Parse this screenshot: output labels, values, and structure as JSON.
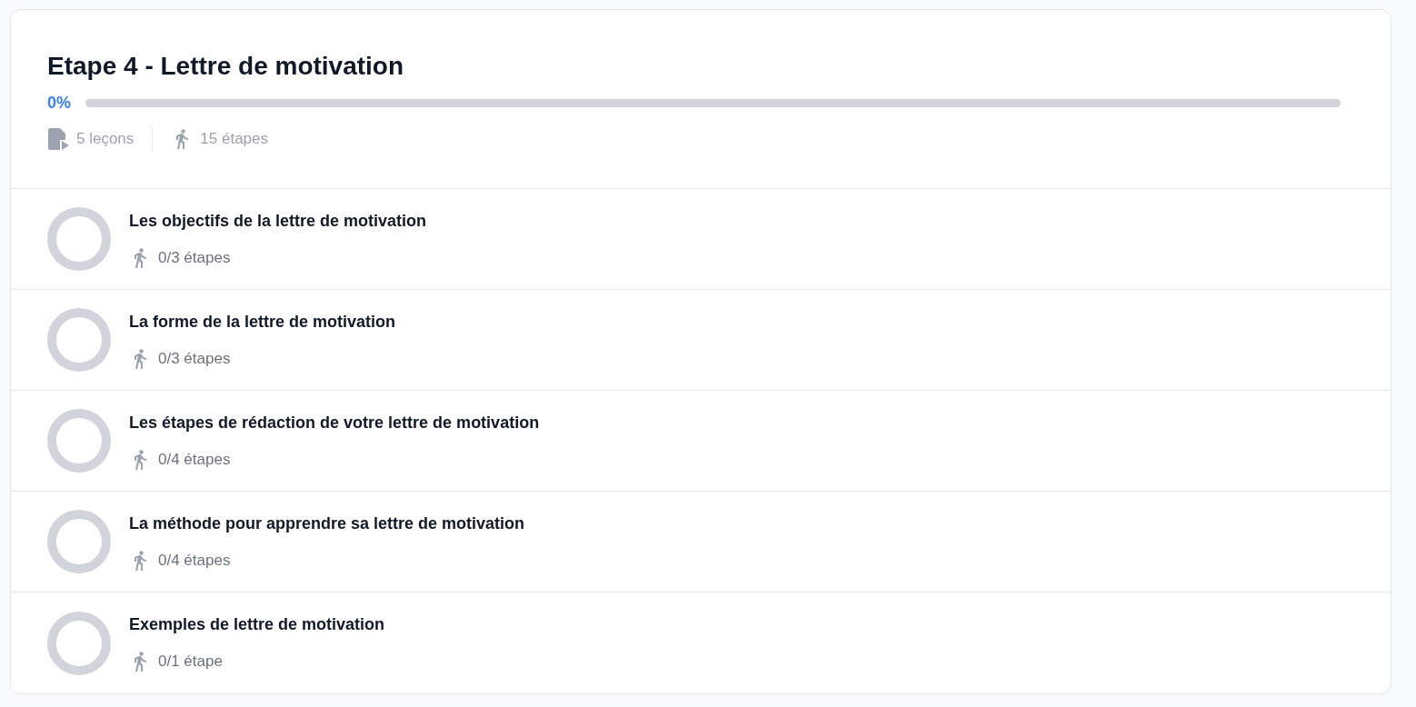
{
  "module": {
    "title": "Etape 4 - Lettre de motivation",
    "progress": {
      "reading": "0%"
    },
    "lessons_count": "5 leçons",
    "steps_count": "15 étapes"
  },
  "lessons": [
    {
      "title": "Les objectifs de la lettre de motivation",
      "steps": "0/3 étapes",
      "level": 0
    },
    {
      "title": "La forme de la lettre de motivation",
      "steps": "0/3 étapes",
      "level": 0
    },
    {
      "title": "Les étapes de rédaction de votre lettre de motivation",
      "steps": "0/4 étapes",
      "level": 0
    },
    {
      "title": "La méthode pour apprendre sa lettre de motivation",
      "steps": "0/4 étapes",
      "level": 0
    },
    {
      "title": "Exemples de lettre de motivation",
      "steps": "0/1 étape",
      "level": 0
    }
  ]
}
